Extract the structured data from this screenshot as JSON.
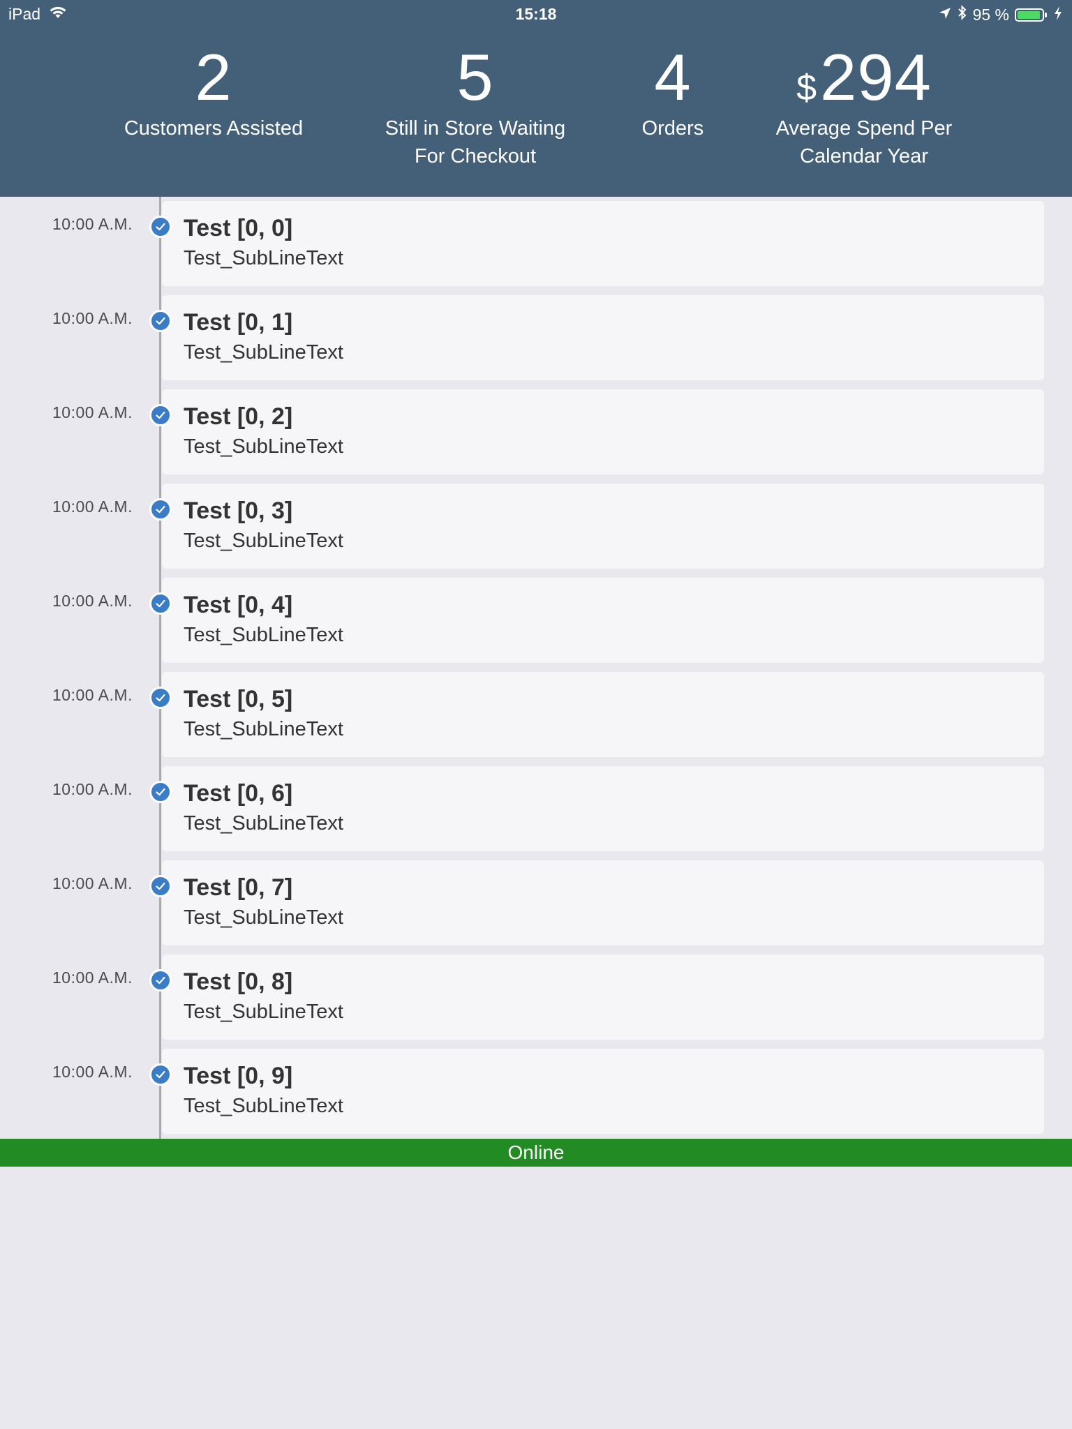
{
  "status_bar": {
    "device": "iPad",
    "time": "15:18",
    "battery_text": "95 %",
    "battery_level": 0.95,
    "icons": [
      "wifi-icon",
      "location-arrow-icon",
      "bluetooth-icon",
      "battery-icon",
      "charging-bolt-icon"
    ]
  },
  "stats": {
    "customers": {
      "value": "2",
      "label_line1": "Customers Assisted",
      "label_line2": ""
    },
    "waiting": {
      "value": "5",
      "label_line1": "Still in Store Waiting",
      "label_line2": "For Checkout"
    },
    "orders": {
      "value": "4",
      "label_line1": "Orders",
      "label_line2": ""
    },
    "average_spend": {
      "currency": "$",
      "value": "294",
      "label_line1": "Average Spend Per",
      "label_line2": "Calendar Year"
    }
  },
  "timeline": {
    "items": [
      {
        "time": "10:00 A.M.",
        "title": "Test [0, 0]",
        "subtitle": "Test_SubLineText"
      },
      {
        "time": "10:00 A.M.",
        "title": "Test [0, 1]",
        "subtitle": "Test_SubLineText"
      },
      {
        "time": "10:00 A.M.",
        "title": "Test [0, 2]",
        "subtitle": "Test_SubLineText"
      },
      {
        "time": "10:00 A.M.",
        "title": "Test [0, 3]",
        "subtitle": "Test_SubLineText"
      },
      {
        "time": "10:00 A.M.",
        "title": "Test [0, 4]",
        "subtitle": "Test_SubLineText"
      },
      {
        "time": "10:00 A.M.",
        "title": "Test [0, 5]",
        "subtitle": "Test_SubLineText"
      },
      {
        "time": "10:00 A.M.",
        "title": "Test [0, 6]",
        "subtitle": "Test_SubLineText"
      },
      {
        "time": "10:00 A.M.",
        "title": "Test [0, 7]",
        "subtitle": "Test_SubLineText"
      },
      {
        "time": "10:00 A.M.",
        "title": "Test [0, 8]",
        "subtitle": "Test_SubLineText"
      },
      {
        "time": "10:00 A.M.",
        "title": "Test [0, 9]",
        "subtitle": "Test_SubLineText"
      }
    ]
  },
  "connection": {
    "status": "Online",
    "color": "#238b23"
  },
  "colors": {
    "header_bg": "#445f78",
    "check_blue": "#3a7cc6",
    "page_bg": "#e9e8ee"
  }
}
